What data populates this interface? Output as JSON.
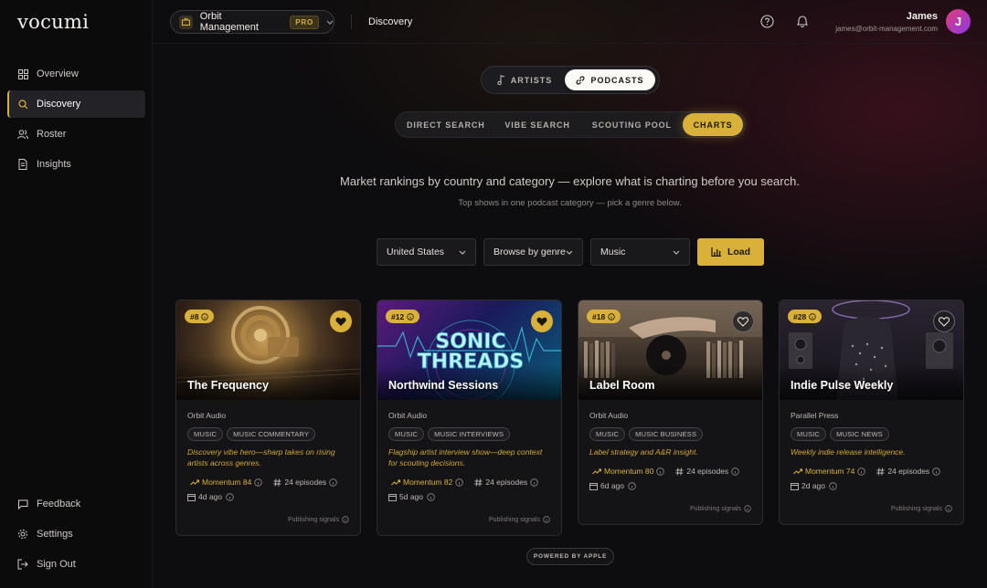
{
  "app": {
    "logo": "vocumi"
  },
  "sidebar": {
    "items": [
      {
        "label": "Overview",
        "icon": "grid-icon"
      },
      {
        "label": "Discovery",
        "icon": "search-icon",
        "active": true
      },
      {
        "label": "Roster",
        "icon": "users-icon"
      },
      {
        "label": "Insights",
        "icon": "document-icon"
      }
    ],
    "bottom": [
      {
        "label": "Feedback",
        "icon": "chat-icon"
      },
      {
        "label": "Settings",
        "icon": "gear-icon"
      },
      {
        "label": "Sign Out",
        "icon": "sign-out-icon"
      }
    ]
  },
  "header": {
    "workspace": "Orbit Management",
    "badge": "PRO",
    "breadcrumb": "Discovery",
    "user_name": "James",
    "user_email": "james@orbit-management.com",
    "avatar_initial": "J"
  },
  "mode_toggle": {
    "artists": "ARTISTS",
    "podcasts": "PODCASTS"
  },
  "tabs": [
    "DIRECT SEARCH",
    "VIBE SEARCH",
    "SCOUTING POOL",
    "CHARTS"
  ],
  "intro": {
    "headline": "Market rankings by country and category — explore what is charting before you search.",
    "subline": "Top shows in one podcast category — pick a genre below."
  },
  "filters": {
    "country": "United States",
    "mode": "Browse by genre",
    "genre": "Music",
    "load_label": "Load"
  },
  "cards": [
    {
      "rank": "#8",
      "title": "The Frequency",
      "publisher": "Orbit Audio",
      "tags": [
        "MUSIC",
        "MUSIC COMMENTARY"
      ],
      "description": "Discovery vibe hero—sharp takes on rising artists across genres.",
      "momentum": "Momentum 84",
      "episodes": "24 episodes",
      "age": "4d ago",
      "signals": "Publishing signals",
      "favorited": true
    },
    {
      "rank": "#12",
      "title": "Northwind Sessions",
      "publisher": "Orbit Audio",
      "tags": [
        "MUSIC",
        "MUSIC INTERVIEWS"
      ],
      "description": "Flagship artist interview show—deep context for scouting decisions.",
      "momentum": "Momentum 82",
      "episodes": "24 episodes",
      "age": "5d ago",
      "signals": "Publishing signals",
      "favorited": true,
      "art_text": [
        "SONIC",
        "THREADS"
      ]
    },
    {
      "rank": "#18",
      "title": "Label Room",
      "publisher": "Orbit Audio",
      "tags": [
        "MUSIC",
        "MUSIC BUSINESS"
      ],
      "description": "Label strategy and A&R insight.",
      "momentum": "Momentum 80",
      "episodes": "24 episodes",
      "age": "6d ago",
      "signals": "Publishing signals",
      "favorited": false
    },
    {
      "rank": "#28",
      "title": "Indie Pulse Weekly",
      "publisher": "Parallel Press",
      "tags": [
        "MUSIC",
        "MUSIC NEWS"
      ],
      "description": "Weekly indie release intelligence.",
      "momentum": "Momentum 74",
      "episodes": "24 episodes",
      "age": "2d ago",
      "signals": "Publishing signals",
      "favorited": false
    }
  ],
  "footer": {
    "powered": "POWERED BY APPLE"
  },
  "colors": {
    "accent": "#d9b13a",
    "background": "#0c0b0d"
  }
}
